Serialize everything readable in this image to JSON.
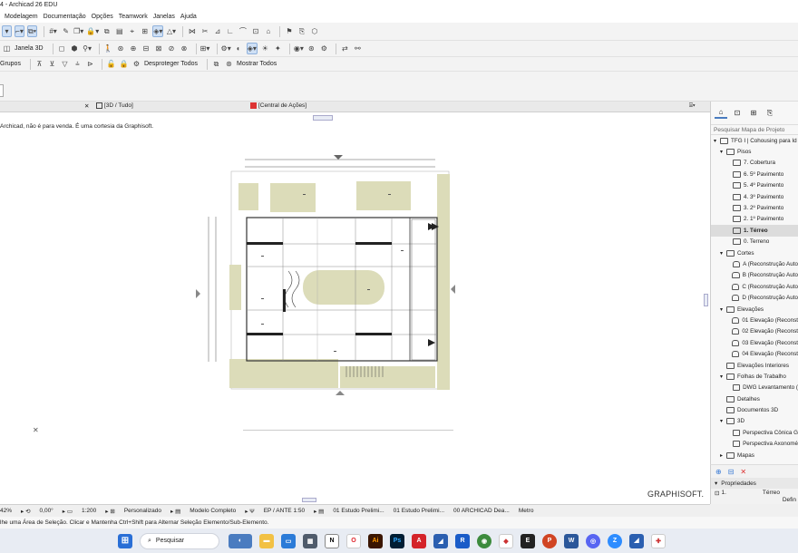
{
  "window": {
    "title": "4 - Archicad 26 EDU"
  },
  "menu": [
    "Modelagem",
    "Documentação",
    "Opções",
    "Teamwork",
    "Janelas",
    "Ajuda"
  ],
  "toolbar3": {
    "janela3d_label": "Janela 3D",
    "desproteger_label": "Desproteger Todos",
    "mostrar_label": "Mostrar Todos",
    "grupos_label": "Grupos"
  },
  "tabs": {
    "tab1": "[3D / Tudo]",
    "tab2": "[Central de Ações]"
  },
  "canvas": {
    "note": "Archicad, não é para venda. É uma cortesia da Graphisoft.",
    "brand": "GRAPHISOFT."
  },
  "navigator": {
    "search_placeholder": "Pesquisar Mapa de Projeto",
    "items": [
      {
        "label": "TFG I | Cohousing para Id",
        "level": 0,
        "chev": "v",
        "icon": "box"
      },
      {
        "label": "Pisos",
        "level": 1,
        "chev": "v",
        "icon": "folder"
      },
      {
        "label": "7. Cobertura",
        "level": 2,
        "chev": "",
        "icon": "folder"
      },
      {
        "label": "6. 5º Pavimento",
        "level": 2,
        "chev": "",
        "icon": "folder"
      },
      {
        "label": "5. 4º Pavimento",
        "level": 2,
        "chev": "",
        "icon": "folder"
      },
      {
        "label": "4. 3º Pavimento",
        "level": 2,
        "chev": "",
        "icon": "folder"
      },
      {
        "label": "3. 2º Pavimento",
        "level": 2,
        "chev": "",
        "icon": "folder"
      },
      {
        "label": "2. 1º Pavimento",
        "level": 2,
        "chev": "",
        "icon": "folder"
      },
      {
        "label": "1. Térreo",
        "level": 2,
        "chev": "",
        "icon": "folder",
        "selected": true
      },
      {
        "label": "0. Terreno",
        "level": 2,
        "chev": "",
        "icon": "folder"
      },
      {
        "label": "Cortes",
        "level": 1,
        "chev": "v",
        "icon": "folder"
      },
      {
        "label": "A (Reconstrução Auto",
        "level": 2,
        "chev": "",
        "icon": "section"
      },
      {
        "label": "B (Reconstrução Auto",
        "level": 2,
        "chev": "",
        "icon": "section"
      },
      {
        "label": "C (Reconstrução Auto",
        "level": 2,
        "chev": "",
        "icon": "section"
      },
      {
        "label": "D (Reconstrução Auto",
        "level": 2,
        "chev": "",
        "icon": "section"
      },
      {
        "label": "Elevações",
        "level": 1,
        "chev": "v",
        "icon": "folder"
      },
      {
        "label": "01 Elevação (Reconst",
        "level": 2,
        "chev": "",
        "icon": "section"
      },
      {
        "label": "02 Elevação (Reconst",
        "level": 2,
        "chev": "",
        "icon": "section"
      },
      {
        "label": "03 Elevação (Reconst",
        "level": 2,
        "chev": "",
        "icon": "section"
      },
      {
        "label": "04 Elevação (Reconst",
        "level": 2,
        "chev": "",
        "icon": "section"
      },
      {
        "label": "Elevações Interiores",
        "level": 1,
        "chev": "",
        "icon": "box"
      },
      {
        "label": "Folhas de Trabalho",
        "level": 1,
        "chev": "v",
        "icon": "box"
      },
      {
        "label": "DWG Levantamento (",
        "level": 2,
        "chev": "",
        "icon": "box"
      },
      {
        "label": "Detalhes",
        "level": 1,
        "chev": "",
        "icon": "box"
      },
      {
        "label": "Documentos 3D",
        "level": 1,
        "chev": "",
        "icon": "box"
      },
      {
        "label": "3D",
        "level": 1,
        "chev": "v",
        "icon": "box"
      },
      {
        "label": "Perspectiva Cônica G",
        "level": 2,
        "chev": "",
        "icon": "box"
      },
      {
        "label": "Perspectiva Axonomé",
        "level": 2,
        "chev": "",
        "icon": "box"
      },
      {
        "label": "Mapas",
        "level": 1,
        "chev": ">",
        "icon": "box"
      }
    ],
    "properties_label": "Propriedades",
    "prop_id": "1.",
    "prop_value": "Térreo",
    "prop_define": "Defin"
  },
  "status": {
    "zoom": "42%",
    "angle": "0,00°",
    "scale": "1:200",
    "custom": "Personalizado",
    "model": "Modelo Completo",
    "ep": "EP / ANTE 1:50",
    "study1": "01 Estudo Prelimi...",
    "study2": "01 Estudo Prelimi...",
    "archicad": "00 ARCHICAD Dea...",
    "unit": "Metro"
  },
  "hint": "lhe uma Área de Seleção. Clicar e Mantenha Ctrl+Shift para Alternar Seleção Elemento/Sub-Elemento.",
  "taskbar": {
    "search_label": "Pesquisar"
  },
  "colors": {
    "accent": "#cfe0f5",
    "site_fill": "#dcdcb9",
    "bg": "#f0f0f0"
  }
}
